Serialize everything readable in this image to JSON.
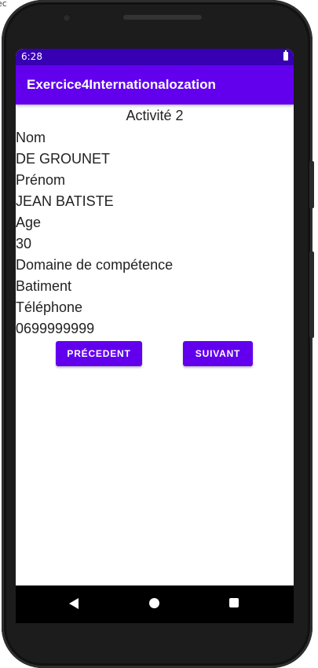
{
  "corner_text": "ec",
  "status_bar": {
    "time": "6:28",
    "battery_icon": "battery-full-icon"
  },
  "app_bar": {
    "title": "Exercice4Internationalozation",
    "color": "#6200ee"
  },
  "activity_title": "Activité 2",
  "fields": [
    "Nom",
    "DE GROUNET",
    "Prénom",
    "JEAN BATISTE",
    "Age",
    "30",
    "Domaine de compétence",
    "Batiment",
    "Téléphone",
    "0699999999"
  ],
  "buttons": {
    "previous": "PRÉCEDENT",
    "next": "SUIVANT"
  },
  "nav_bar": {
    "icons": [
      "back-icon",
      "home-icon",
      "recents-icon"
    ]
  },
  "colors": {
    "status_bar": "#3700b3",
    "accent": "#6200ee"
  }
}
